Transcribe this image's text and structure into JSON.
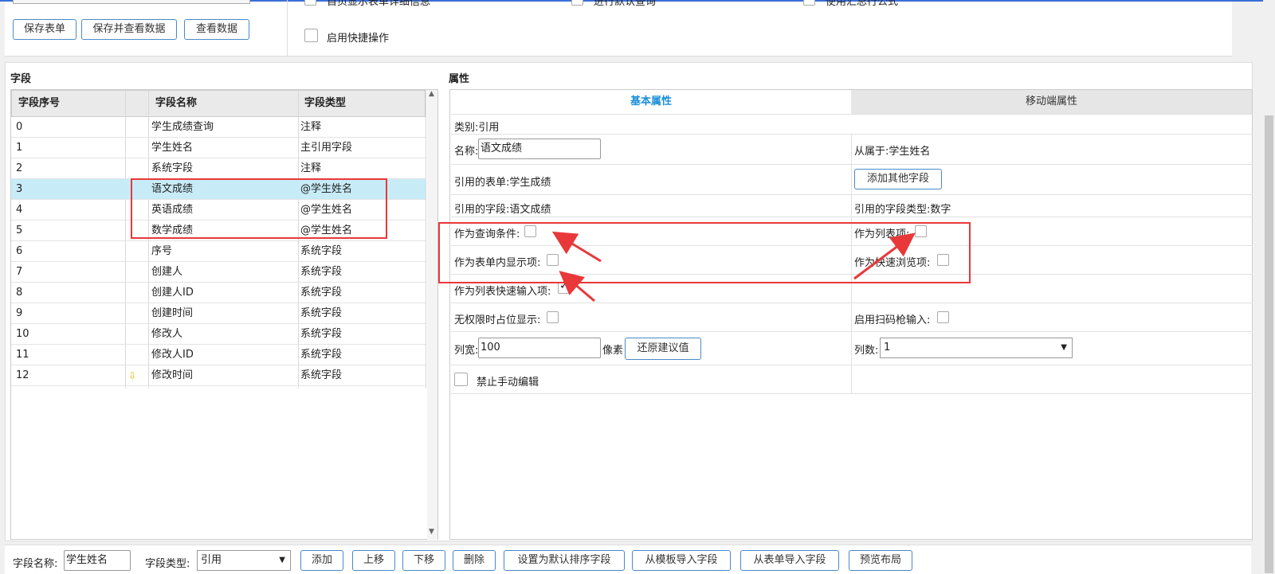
{
  "toolbar": {
    "save_form": "保存表单",
    "save_and_view": "保存并查看数据",
    "view_data": "查看数据",
    "opt_detail": "首页显示表单详细信息",
    "opt_default_query": "进行默认查询",
    "opt_summary_formula": "使用汇总行公式",
    "opt_quick_ops": "启用快捷操作"
  },
  "fields": {
    "section_title": "字段",
    "columns": [
      "字段序号",
      "字段名称",
      "字段类型"
    ],
    "rows": [
      {
        "no": "0",
        "name": "学生成绩查询",
        "type": "注释"
      },
      {
        "no": "1",
        "name": "学生姓名",
        "type": "主引用字段"
      },
      {
        "no": "2",
        "name": "系统字段",
        "type": "注释"
      },
      {
        "no": "3",
        "name": "语文成绩",
        "type": "@学生姓名"
      },
      {
        "no": "4",
        "name": "英语成绩",
        "type": "@学生姓名"
      },
      {
        "no": "5",
        "name": "数学成绩",
        "type": "@学生姓名"
      },
      {
        "no": "6",
        "name": "序号",
        "type": "系统字段"
      },
      {
        "no": "7",
        "name": "创建人",
        "type": "系统字段"
      },
      {
        "no": "8",
        "name": "创建人ID",
        "type": "系统字段"
      },
      {
        "no": "9",
        "name": "创建时间",
        "type": "系统字段"
      },
      {
        "no": "10",
        "name": "修改人",
        "type": "系统字段"
      },
      {
        "no": "11",
        "name": "修改人ID",
        "type": "系统字段"
      },
      {
        "no": "12",
        "name": "修改时间",
        "type": "系统字段"
      }
    ],
    "selected_index": 3
  },
  "properties": {
    "section_title": "属性",
    "tab_basic": "基本属性",
    "tab_mobile": "移动端属性",
    "category": "类别:引用",
    "name_label": "名称:",
    "name_value": "语文成绩",
    "belongs_to": "从属于:学生姓名",
    "ref_form": "引用的表单:学生成绩",
    "add_other_field": "添加其他字段",
    "ref_field": "引用的字段:语文成绩",
    "ref_field_type": "引用的字段类型:数字",
    "as_query_condition": "作为查询条件:",
    "as_list_item": "作为列表项:",
    "as_form_display": "作为表单内显示项:",
    "as_quick_browse": "作为快速浏览项:",
    "as_list_quick_input": "作为列表快速输入项:",
    "no_perm_placeholder": "无权限时占位显示:",
    "enable_scanner": "启用扫码枪输入:",
    "col_width_label": "列宽:",
    "col_width_value": "100",
    "pixel_label": "像素",
    "restore_suggest": "还原建议值",
    "col_count_label": "列数:",
    "col_count_value": "1",
    "disable_manual_edit": "禁止手动编辑"
  },
  "bottom": {
    "field_name_label": "字段名称:",
    "field_name_value": "学生姓名",
    "field_type_label": "字段类型:",
    "field_type_value": "引用",
    "add": "添加",
    "move_up": "上移",
    "move_down": "下移",
    "delete": "删除",
    "set_default_sort": "设置为默认排序字段",
    "import_from_template": "从模板导入字段",
    "import_from_form": "从表单导入字段",
    "preview_layout": "预览布局"
  },
  "colors": {
    "accent": "#1a8fd8",
    "selected_row": "#c7ecf7",
    "annotation_red": "#e8383a"
  }
}
